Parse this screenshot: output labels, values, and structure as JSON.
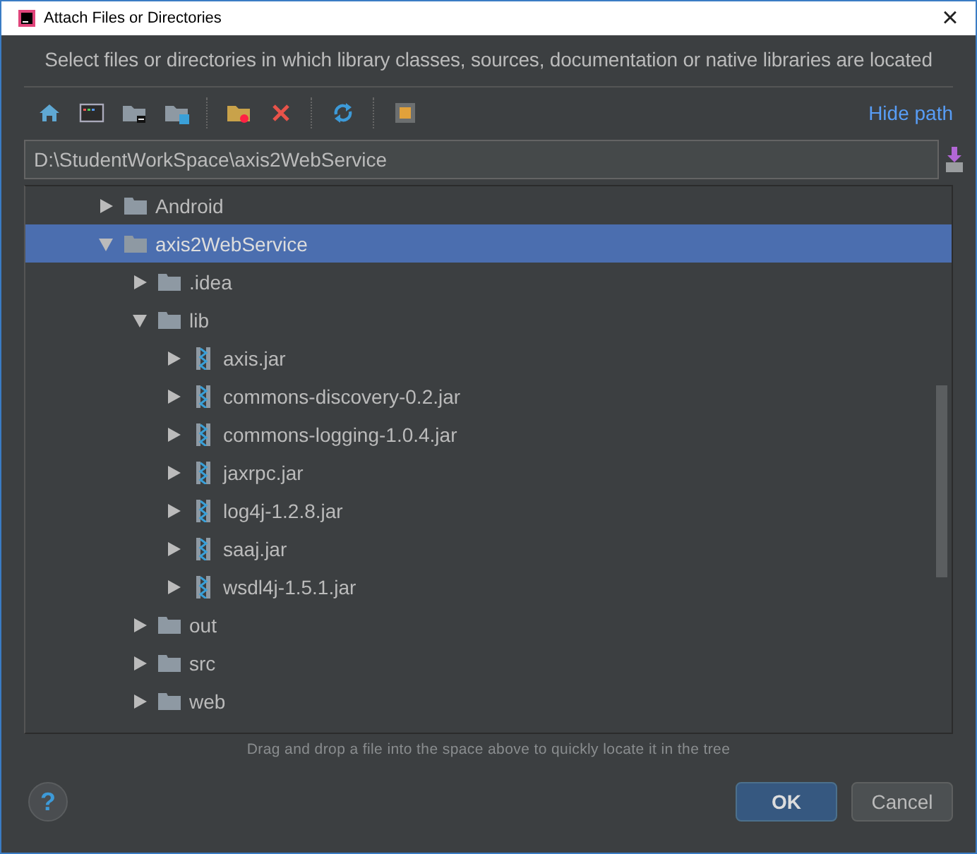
{
  "window": {
    "title": "Attach Files or Directories",
    "close": "×"
  },
  "description": "Select files or directories in which library classes, sources, documentation or native libraries are located",
  "toolbar": {
    "hide_path": "Hide path"
  },
  "path_field": {
    "value": "D:\\StudentWorkSpace\\axis2WebService"
  },
  "tree": [
    {
      "label": "Android",
      "kind": "folder",
      "expanded": false,
      "selected": false
    },
    {
      "label": "axis2WebService",
      "kind": "folder",
      "expanded": true,
      "selected": true,
      "children": [
        {
          "label": ".idea",
          "kind": "folder",
          "expanded": false,
          "selected": false
        },
        {
          "label": "lib",
          "kind": "folder",
          "expanded": true,
          "selected": false,
          "children": [
            {
              "label": "axis.jar",
              "kind": "jar",
              "expanded": false,
              "selected": false
            },
            {
              "label": "commons-discovery-0.2.jar",
              "kind": "jar",
              "expanded": false,
              "selected": false
            },
            {
              "label": "commons-logging-1.0.4.jar",
              "kind": "jar",
              "expanded": false,
              "selected": false
            },
            {
              "label": "jaxrpc.jar",
              "kind": "jar",
              "expanded": false,
              "selected": false
            },
            {
              "label": "log4j-1.2.8.jar",
              "kind": "jar",
              "expanded": false,
              "selected": false
            },
            {
              "label": "saaj.jar",
              "kind": "jar",
              "expanded": false,
              "selected": false
            },
            {
              "label": "wsdl4j-1.5.1.jar",
              "kind": "jar",
              "expanded": false,
              "selected": false
            }
          ]
        },
        {
          "label": "out",
          "kind": "folder",
          "expanded": false,
          "selected": false
        },
        {
          "label": "src",
          "kind": "folder",
          "expanded": false,
          "selected": false
        },
        {
          "label": "web",
          "kind": "folder",
          "expanded": false,
          "selected": false
        }
      ]
    }
  ],
  "hint": "Drag and drop a file into the space above to quickly locate it in the tree",
  "help": "?",
  "buttons": [
    {
      "label": "OK",
      "kind": "default"
    },
    {
      "label": "Cancel",
      "kind": "normal"
    }
  ]
}
